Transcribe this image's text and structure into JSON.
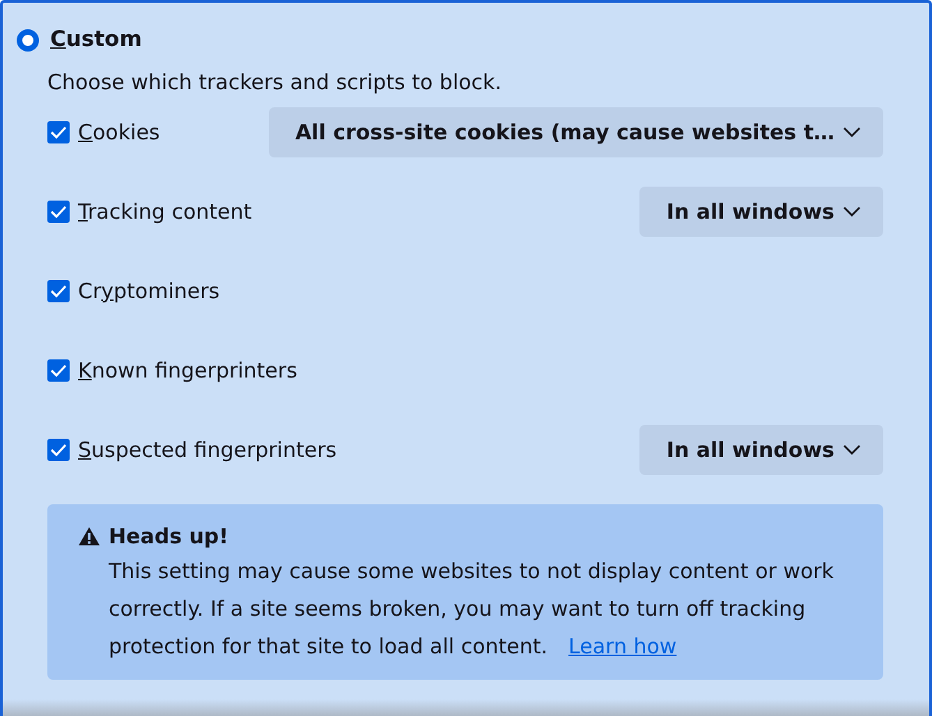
{
  "option": {
    "selected": true,
    "access_key": "C",
    "label_rest": "ustom"
  },
  "description": "Choose which trackers and scripts to block.",
  "items": [
    {
      "checked": true,
      "access_key": "C",
      "label_rest": "ookies",
      "dropdown": "All cross-site cookies (may cause websites t…"
    },
    {
      "checked": true,
      "access_key": "T",
      "label_rest": "racking content",
      "dropdown": "In all windows"
    },
    {
      "checked": true,
      "label_start": "Cr",
      "access_key": "y",
      "label_rest": "ptominers"
    },
    {
      "checked": true,
      "access_key": "K",
      "label_rest": "nown fingerprinters"
    },
    {
      "checked": true,
      "access_key": "S",
      "label_rest": "uspected fingerprinters",
      "dropdown": "In all windows"
    }
  ],
  "notice": {
    "title": "Heads up!",
    "text": "This setting may cause some websites to not display content or work correctly. If a site seems broken, you may want to turn off tracking protection for that site to load all content.",
    "link": "Learn how"
  }
}
